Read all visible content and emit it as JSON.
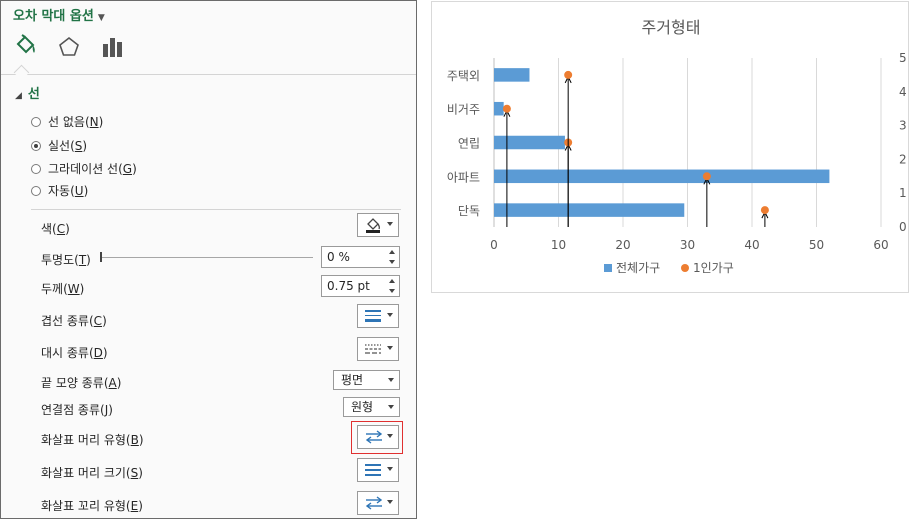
{
  "panel": {
    "title": "오차 막대 옵션",
    "tabs": [
      {
        "name": "fill-line-icon"
      },
      {
        "name": "effects-pentagon-icon"
      },
      {
        "name": "series-options-bar-icon"
      }
    ],
    "section_title": "선",
    "line_options": [
      {
        "label": "선 없음",
        "key": "N",
        "selected": false
      },
      {
        "label": "실선",
        "key": "S",
        "selected": true
      },
      {
        "label": "그라데이션 선",
        "key": "G",
        "selected": false
      },
      {
        "label": "자동",
        "key": "U",
        "selected": false
      }
    ],
    "props": {
      "color": {
        "label": "색",
        "key": "C"
      },
      "transparency": {
        "label": "투명도",
        "key": "T",
        "value": "0 %",
        "fraction": 0
      },
      "width": {
        "label": "두께",
        "key": "W",
        "value": "0.75 pt"
      },
      "compound": {
        "label": "겹선 종류",
        "key": "C"
      },
      "dash": {
        "label": "대시 종류",
        "key": "D"
      },
      "cap": {
        "label": "끝 모양 종류",
        "key": "A",
        "value": "평면"
      },
      "join": {
        "label": "연결점 종류",
        "key": "J",
        "value": "원형"
      },
      "begin_arrow_type": {
        "label": "화살표 머리 유형",
        "key": "B"
      },
      "begin_arrow_size": {
        "label": "화살표 머리 크기",
        "key": "S"
      },
      "end_arrow_type": {
        "label": "화살표 꼬리 유형",
        "key": "E"
      }
    }
  },
  "chart_data": {
    "type": "bar",
    "title": "주거형태",
    "categories": [
      "단독",
      "아파트",
      "연립",
      "비거주",
      "주택외"
    ],
    "x_ticks": [
      "0",
      "10",
      "20",
      "30",
      "40",
      "50",
      "60"
    ],
    "y2_ticks": [
      "0",
      "1",
      "2",
      "3",
      "4",
      "5"
    ],
    "xlim": [
      0,
      60
    ],
    "y2lim": [
      0,
      5
    ],
    "series": [
      {
        "name": "전체가구",
        "kind": "bar",
        "color": "#5b9bd5",
        "values": [
          29.5,
          52,
          11,
          1.5,
          5.5
        ]
      },
      {
        "name": "1인가구",
        "kind": "scatter",
        "color": "#ed7d31",
        "points": [
          {
            "x": 42,
            "y": 0.5
          },
          {
            "x": 33,
            "y": 1.5
          },
          {
            "x": 11.5,
            "y": 2.5
          },
          {
            "x": 2,
            "y": 3.5
          },
          {
            "x": 11.5,
            "y": 4.5
          }
        ]
      }
    ],
    "error_bars": {
      "direction": "minus",
      "axis": "y",
      "color": "#000000"
    },
    "legend": "bottom",
    "grid": true
  }
}
